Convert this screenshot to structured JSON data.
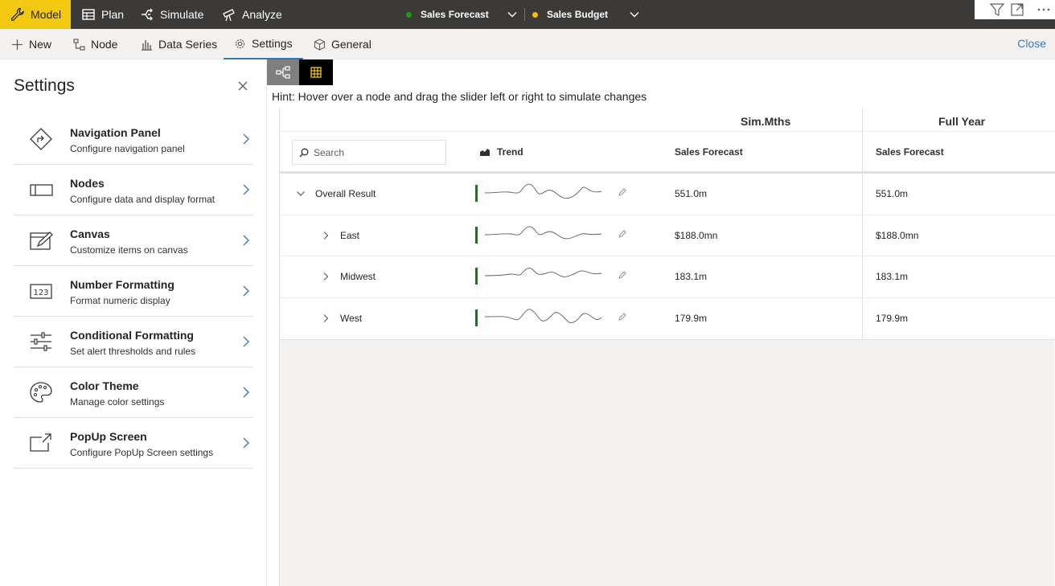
{
  "topbar": {
    "nav": [
      {
        "label": "Model",
        "icon": "wrench-icon",
        "active": true
      },
      {
        "label": "Plan",
        "icon": "table-icon",
        "active": false
      },
      {
        "label": "Simulate",
        "icon": "simulate-icon",
        "active": false
      },
      {
        "label": "Analyze",
        "icon": "telescope-icon",
        "active": false
      }
    ],
    "scenarios": [
      {
        "label": "Sales Forecast",
        "color": "#13a10e"
      },
      {
        "label": "Sales Budget",
        "color": "#ffb900"
      }
    ]
  },
  "ribbon": {
    "items": [
      {
        "label": "New",
        "icon": "plus-icon"
      },
      {
        "label": "Node",
        "icon": "node-icon"
      },
      {
        "label": "Data Series",
        "icon": "bar-chart-icon"
      },
      {
        "label": "Settings",
        "icon": "gear-icon",
        "active": true
      },
      {
        "label": "General",
        "icon": "cube-icon"
      }
    ],
    "close_label": "Close"
  },
  "settings": {
    "title": "Settings",
    "items": [
      {
        "title": "Navigation Panel",
        "subtitle": "Configure navigation panel",
        "icon": "directions-icon"
      },
      {
        "title": "Nodes",
        "subtitle": "Configure data and display format",
        "icon": "node-box-icon"
      },
      {
        "title": "Canvas",
        "subtitle": "Customize items on canvas",
        "icon": "canvas-edit-icon"
      },
      {
        "title": "Number Formatting",
        "subtitle": "Format numeric display",
        "icon": "number-123-icon"
      },
      {
        "title": "Conditional Formatting",
        "subtitle": "Set alert thresholds and rules",
        "icon": "sliders-icon"
      },
      {
        "title": "Color Theme",
        "subtitle": "Manage color settings",
        "icon": "palette-icon"
      },
      {
        "title": "PopUp Screen",
        "subtitle": "Configure PopUp Screen settings",
        "icon": "popup-icon"
      }
    ]
  },
  "main": {
    "hint": "Hint: Hover over a node and drag the slider left or right to simulate changes",
    "table": {
      "group_headers": [
        "Sim.Mths",
        "Full Year"
      ],
      "search_placeholder": "Search",
      "trend_label": "Trend",
      "column_headers": [
        "Sales Forecast",
        "Sales Forecast"
      ],
      "rows": [
        {
          "label": "Overall Result",
          "level": 0,
          "expanded": true,
          "sim": "551.0m",
          "full": "551.0m",
          "trend_color": "#107c10"
        },
        {
          "label": "East",
          "level": 1,
          "expanded": false,
          "sim": "$188.0mn",
          "full": "$188.0mn",
          "trend_color": "#107c10"
        },
        {
          "label": "Midwest",
          "level": 1,
          "expanded": false,
          "sim": "183.1m",
          "full": "183.1m",
          "trend_color": "#107c10"
        },
        {
          "label": "West",
          "level": 1,
          "expanded": false,
          "sim": "179.9m",
          "full": "179.9m",
          "trend_color": "#107c10"
        }
      ]
    }
  }
}
